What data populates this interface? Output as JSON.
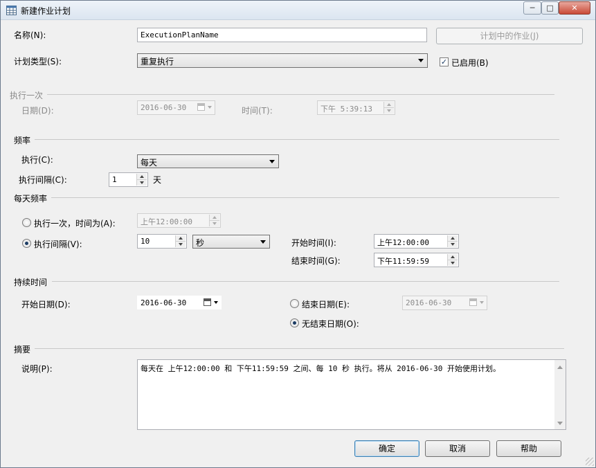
{
  "window": {
    "title": "新建作业计划",
    "min": "─",
    "max": "□",
    "close": "✕"
  },
  "name": {
    "label": "名称(N):",
    "value": "ExecutionPlanName",
    "jobs_button": "计划中的作业(J)"
  },
  "schedule_type": {
    "label": "计划类型(S):",
    "value": "重复执行",
    "enabled_label": "已启用(B)",
    "enabled": true
  },
  "once": {
    "section": "执行一次",
    "date_label": "日期(D):",
    "date_value": "2016-06-30",
    "time_label": "时间(T):",
    "time_value": "下午 5:39:13"
  },
  "frequency": {
    "section": "频率",
    "occurs_label": "执行(C):",
    "occurs_value": "每天",
    "recurs_label": "执行间隔(C):",
    "recurs_value": "1",
    "recurs_unit": "天"
  },
  "daily": {
    "section": "每天频率",
    "once_label": "执行一次，时间为(A):",
    "once_value": "上午12:00:00",
    "every_label": "执行间隔(V):",
    "every_value": "10",
    "every_unit": "秒",
    "start_label": "开始时间(I):",
    "start_value": "上午12:00:00",
    "end_label": "结束时间(G):",
    "end_value": "下午11:59:59"
  },
  "duration": {
    "section": "持续时间",
    "start_label": "开始日期(D):",
    "start_value": "2016-06-30",
    "end_label": "结束日期(E):",
    "end_value": "2016-06-30",
    "no_end_label": "无结束日期(O):"
  },
  "summary": {
    "section": "摘要",
    "desc_label": "说明(P):",
    "text": "每天在 上午12:00:00 和 下午11:59:59 之间、每 10 秒 执行。将从 2016-06-30 开始使用计划。"
  },
  "buttons": {
    "ok": "确定",
    "cancel": "取消",
    "help": "帮助"
  }
}
